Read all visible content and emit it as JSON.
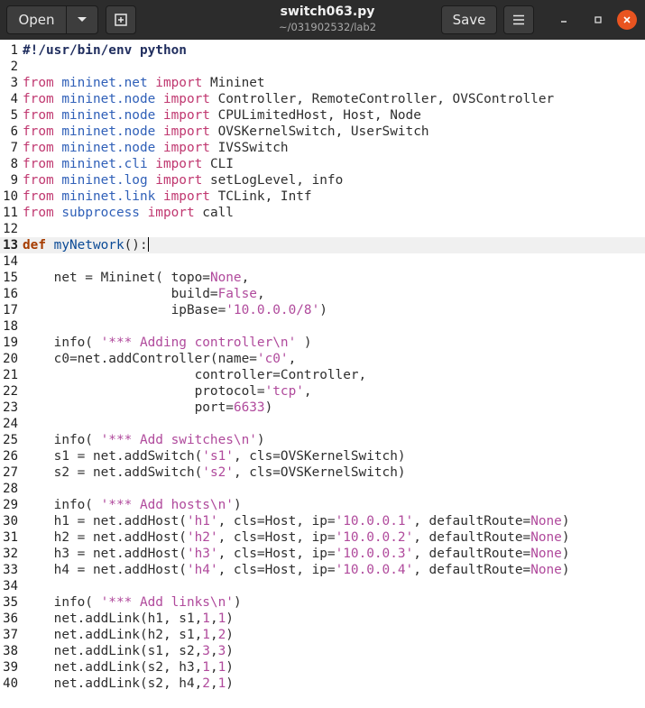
{
  "header": {
    "open_label": "Open",
    "title": "switch063.py",
    "subtitle": "~/031902532/lab2",
    "save_label": "Save"
  },
  "editor": {
    "current_line": 13,
    "lines": [
      [
        [
          "shebang",
          "#!/usr/bin/env python"
        ]
      ],
      [],
      [
        [
          "kw2",
          "from "
        ],
        [
          "mod",
          "mininet.net"
        ],
        [
          "kw2",
          " import "
        ],
        [
          "t",
          "Mininet"
        ]
      ],
      [
        [
          "kw2",
          "from "
        ],
        [
          "mod",
          "mininet.node"
        ],
        [
          "kw2",
          " import "
        ],
        [
          "t",
          "Controller, RemoteController, OVSController"
        ]
      ],
      [
        [
          "kw2",
          "from "
        ],
        [
          "mod",
          "mininet.node"
        ],
        [
          "kw2",
          " import "
        ],
        [
          "t",
          "CPULimitedHost, Host, Node"
        ]
      ],
      [
        [
          "kw2",
          "from "
        ],
        [
          "mod",
          "mininet.node"
        ],
        [
          "kw2",
          " import "
        ],
        [
          "t",
          "OVSKernelSwitch, UserSwitch"
        ]
      ],
      [
        [
          "kw2",
          "from "
        ],
        [
          "mod",
          "mininet.node"
        ],
        [
          "kw2",
          " import "
        ],
        [
          "t",
          "IVSSwitch"
        ]
      ],
      [
        [
          "kw2",
          "from "
        ],
        [
          "mod",
          "mininet.cli"
        ],
        [
          "kw2",
          " import "
        ],
        [
          "t",
          "CLI"
        ]
      ],
      [
        [
          "kw2",
          "from "
        ],
        [
          "mod",
          "mininet.log"
        ],
        [
          "kw2",
          " import "
        ],
        [
          "t",
          "setLogLevel, info"
        ]
      ],
      [
        [
          "kw2",
          "from "
        ],
        [
          "mod",
          "mininet.link"
        ],
        [
          "kw2",
          " import "
        ],
        [
          "t",
          "TCLink, Intf"
        ]
      ],
      [
        [
          "kw2",
          "from "
        ],
        [
          "mod",
          "subprocess"
        ],
        [
          "kw2",
          " import "
        ],
        [
          "t",
          "call"
        ]
      ],
      [],
      [
        [
          "kw",
          "def "
        ],
        [
          "fn",
          "myNetwork"
        ],
        [
          "t",
          "():"
        ]
      ],
      [],
      [
        [
          "t",
          "    net = Mininet( topo="
        ],
        [
          "const",
          "None"
        ],
        [
          "t",
          ","
        ]
      ],
      [
        [
          "t",
          "                   build="
        ],
        [
          "const",
          "False"
        ],
        [
          "t",
          ","
        ]
      ],
      [
        [
          "t",
          "                   ipBase="
        ],
        [
          "str",
          "'10.0.0.0/8'"
        ],
        [
          "t",
          ")"
        ]
      ],
      [],
      [
        [
          "t",
          "    info( "
        ],
        [
          "str",
          "'*** Adding controller\\n'"
        ],
        [
          "t",
          " )"
        ]
      ],
      [
        [
          "t",
          "    c0=net.addController(name="
        ],
        [
          "str",
          "'c0'"
        ],
        [
          "t",
          ","
        ]
      ],
      [
        [
          "t",
          "                      controller=Controller,"
        ]
      ],
      [
        [
          "t",
          "                      protocol="
        ],
        [
          "str",
          "'tcp'"
        ],
        [
          "t",
          ","
        ]
      ],
      [
        [
          "t",
          "                      port="
        ],
        [
          "num",
          "6633"
        ],
        [
          "t",
          ")"
        ]
      ],
      [],
      [
        [
          "t",
          "    info( "
        ],
        [
          "str",
          "'*** Add switches\\n'"
        ],
        [
          "t",
          ")"
        ]
      ],
      [
        [
          "t",
          "    s1 = net.addSwitch("
        ],
        [
          "str",
          "'s1'"
        ],
        [
          "t",
          ", cls=OVSKernelSwitch)"
        ]
      ],
      [
        [
          "t",
          "    s2 = net.addSwitch("
        ],
        [
          "str",
          "'s2'"
        ],
        [
          "t",
          ", cls=OVSKernelSwitch)"
        ]
      ],
      [],
      [
        [
          "t",
          "    info( "
        ],
        [
          "str",
          "'*** Add hosts\\n'"
        ],
        [
          "t",
          ")"
        ]
      ],
      [
        [
          "t",
          "    h1 = net.addHost("
        ],
        [
          "str",
          "'h1'"
        ],
        [
          "t",
          ", cls=Host, ip="
        ],
        [
          "str",
          "'10.0.0.1'"
        ],
        [
          "t",
          ", defaultRoute="
        ],
        [
          "const",
          "None"
        ],
        [
          "t",
          ")"
        ]
      ],
      [
        [
          "t",
          "    h2 = net.addHost("
        ],
        [
          "str",
          "'h2'"
        ],
        [
          "t",
          ", cls=Host, ip="
        ],
        [
          "str",
          "'10.0.0.2'"
        ],
        [
          "t",
          ", defaultRoute="
        ],
        [
          "const",
          "None"
        ],
        [
          "t",
          ")"
        ]
      ],
      [
        [
          "t",
          "    h3 = net.addHost("
        ],
        [
          "str",
          "'h3'"
        ],
        [
          "t",
          ", cls=Host, ip="
        ],
        [
          "str",
          "'10.0.0.3'"
        ],
        [
          "t",
          ", defaultRoute="
        ],
        [
          "const",
          "None"
        ],
        [
          "t",
          ")"
        ]
      ],
      [
        [
          "t",
          "    h4 = net.addHost("
        ],
        [
          "str",
          "'h4'"
        ],
        [
          "t",
          ", cls=Host, ip="
        ],
        [
          "str",
          "'10.0.0.4'"
        ],
        [
          "t",
          ", defaultRoute="
        ],
        [
          "const",
          "None"
        ],
        [
          "t",
          ")"
        ]
      ],
      [],
      [
        [
          "t",
          "    info( "
        ],
        [
          "str",
          "'*** Add links\\n'"
        ],
        [
          "t",
          ")"
        ]
      ],
      [
        [
          "t",
          "    net.addLink(h1, s1,"
        ],
        [
          "num",
          "1"
        ],
        [
          "t",
          ","
        ],
        [
          "num",
          "1"
        ],
        [
          "t",
          ")"
        ]
      ],
      [
        [
          "t",
          "    net.addLink(h2, s1,"
        ],
        [
          "num",
          "1"
        ],
        [
          "t",
          ","
        ],
        [
          "num",
          "2"
        ],
        [
          "t",
          ")"
        ]
      ],
      [
        [
          "t",
          "    net.addLink(s1, s2,"
        ],
        [
          "num",
          "3"
        ],
        [
          "t",
          ","
        ],
        [
          "num",
          "3"
        ],
        [
          "t",
          ")"
        ]
      ],
      [
        [
          "t",
          "    net.addLink(s2, h3,"
        ],
        [
          "num",
          "1"
        ],
        [
          "t",
          ","
        ],
        [
          "num",
          "1"
        ],
        [
          "t",
          ")"
        ]
      ],
      [
        [
          "t",
          "    net.addLink(s2, h4,"
        ],
        [
          "num",
          "2"
        ],
        [
          "t",
          ","
        ],
        [
          "num",
          "1"
        ],
        [
          "t",
          ")"
        ]
      ],
      [
        [
          "t",
          ""
        ]
      ]
    ],
    "line_numbers": [
      "1",
      "2",
      "3",
      "4",
      "5",
      "6",
      "7",
      "8",
      "9",
      "10",
      "11",
      "12",
      "13",
      "14",
      "15",
      "16",
      "17",
      "18",
      "19",
      "20",
      "21",
      "22",
      "23",
      "24",
      "25",
      "26",
      "27",
      "28",
      "29",
      "30",
      "31",
      "32",
      "33",
      "34",
      "35",
      "36",
      "37",
      "38",
      "39",
      "40"
    ]
  }
}
